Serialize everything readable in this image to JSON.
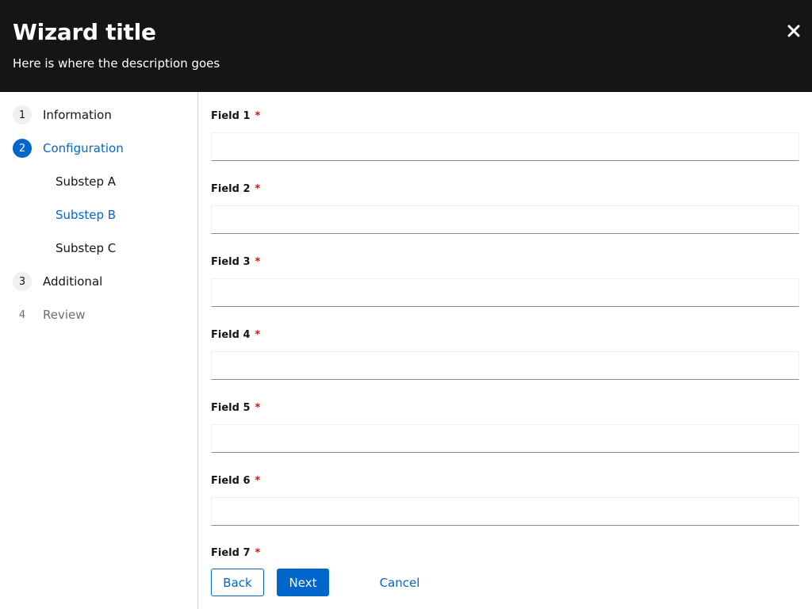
{
  "header": {
    "title": "Wizard title",
    "description": "Here is where the description goes"
  },
  "nav": {
    "steps": [
      {
        "number": "1",
        "label": "Information"
      },
      {
        "number": "2",
        "label": "Configuration"
      },
      {
        "number": "3",
        "label": "Additional"
      },
      {
        "number": "4",
        "label": "Review"
      }
    ],
    "substeps": [
      {
        "label": "Substep A"
      },
      {
        "label": "Substep B"
      },
      {
        "label": "Substep C"
      }
    ]
  },
  "form": {
    "required_marker": "*",
    "fields": [
      {
        "label": "Field 1",
        "value": ""
      },
      {
        "label": "Field 2",
        "value": ""
      },
      {
        "label": "Field 3",
        "value": ""
      },
      {
        "label": "Field 4",
        "value": ""
      },
      {
        "label": "Field 5",
        "value": ""
      },
      {
        "label": "Field 6",
        "value": ""
      },
      {
        "label": "Field 7",
        "value": ""
      }
    ]
  },
  "footer": {
    "back_label": "Back",
    "next_label": "Next",
    "cancel_label": "Cancel"
  },
  "colors": {
    "header_bg": "#151515",
    "accent": "#0066cc",
    "required": "#c9190b",
    "disabled_text": "#6a6e73"
  },
  "icons": {
    "close": "close-icon"
  }
}
